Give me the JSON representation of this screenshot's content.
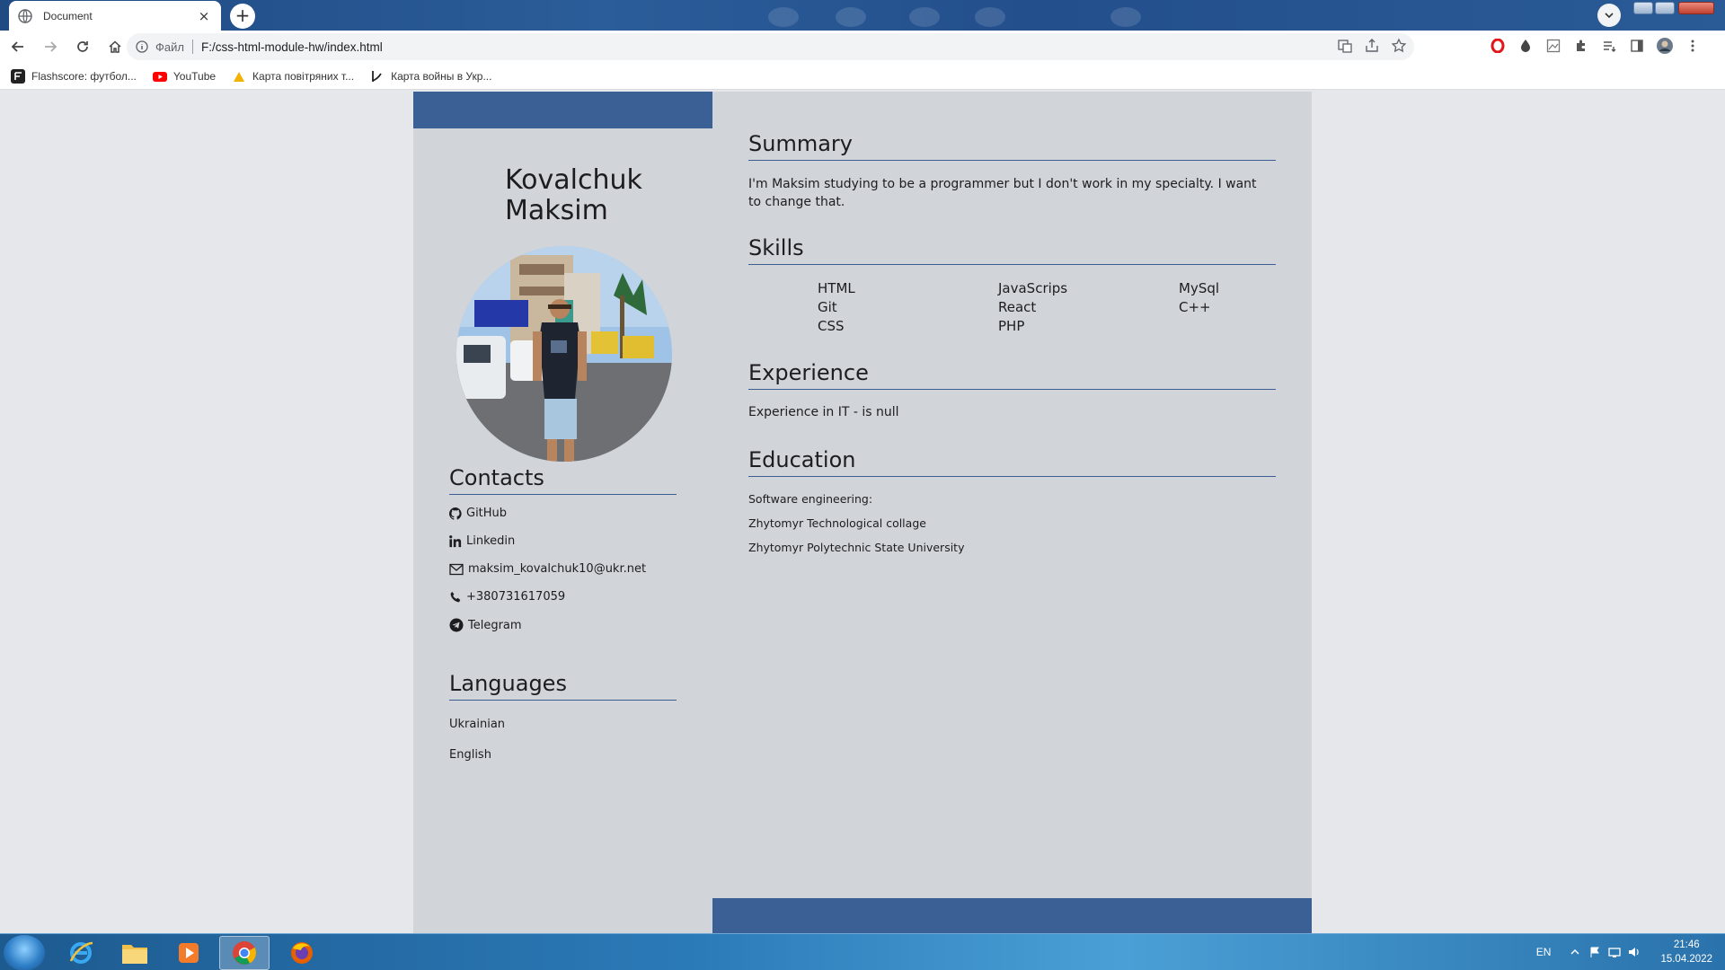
{
  "browser": {
    "tab_title": "Document",
    "new_tab": "+",
    "tab_close": "×",
    "url_scheme": "Файл",
    "url": "F:/css-html-module-hw/index.html",
    "bookmarks": [
      {
        "label": "Flashscore: футбол...",
        "color": "#222222"
      },
      {
        "label": "YouTube",
        "color": "#ff0000"
      },
      {
        "label": "Карта повітряних т...",
        "color": "#f3b200"
      },
      {
        "label": "Карта войны в Укр...",
        "color": "#222222"
      }
    ]
  },
  "resume": {
    "name_first": "Kovalchuk",
    "name_last": "Maksim",
    "accent": "#3b6095",
    "contacts_title": "Contacts",
    "contacts": [
      {
        "icon": "github-icon",
        "label": "GitHub"
      },
      {
        "icon": "linkedin-icon",
        "label": "Linkedin"
      },
      {
        "icon": "mail-icon",
        "label": "maksim_kovalchuk10@ukr.net"
      },
      {
        "icon": "phone-icon",
        "label": "+380731617059"
      },
      {
        "icon": "telegram-icon",
        "label": "Telegram"
      }
    ],
    "languages_title": "Languages",
    "languages": [
      "Ukrainian",
      "English"
    ],
    "summary_title": "Summary",
    "summary_text": "I'm Maksim studying to be a programmer but I don't work in my specialty. I want to change that.",
    "skills_title": "Skills",
    "skills": [
      "HTML",
      "JavaScrips",
      "MySql",
      "Git",
      "React",
      "C++",
      "CSS",
      "PHP"
    ],
    "experience_title": "Experience",
    "experience_text": "Experience in IT - is null",
    "education_title": "Education",
    "education": [
      "Software engineering:",
      "Zhytomyr Technological collage",
      "Zhytomyr Polytechnic State University"
    ]
  },
  "taskbar": {
    "lang": "EN",
    "time": "21:46",
    "date": "15.04.2022"
  }
}
